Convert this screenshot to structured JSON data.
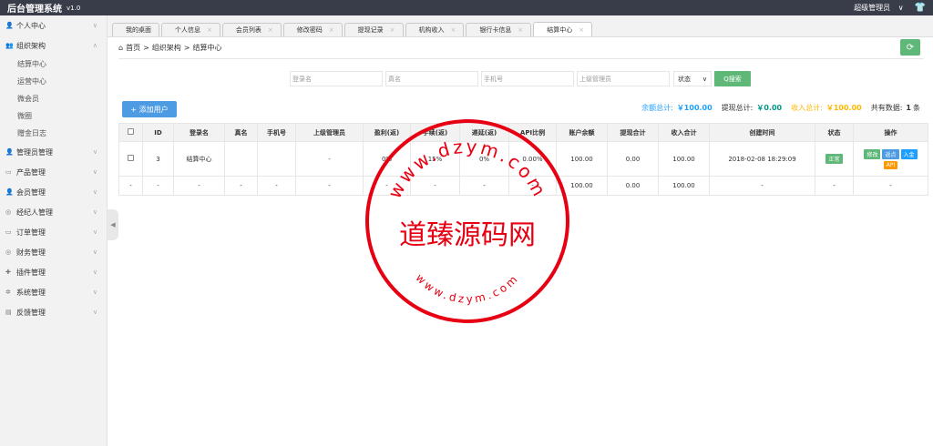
{
  "topbar": {
    "title": "后台管理系统",
    "version": "v1.0",
    "user": "超级管理员",
    "user_chevron": "∨",
    "shirt_icon": "👕"
  },
  "sidebar": {
    "items": [
      {
        "icon": "user-icon",
        "glyph": "👤",
        "label": "个人中心",
        "arrow": "∨"
      },
      {
        "icon": "org-icon",
        "glyph": "👥",
        "label": "组织架构",
        "arrow": "∧"
      },
      {
        "icon": "admin-icon",
        "glyph": "👤",
        "label": "管理员管理",
        "arrow": "∨"
      },
      {
        "icon": "product-icon",
        "glyph": "▭",
        "label": "产品管理",
        "arrow": "∨"
      },
      {
        "icon": "member-icon",
        "glyph": "👤",
        "label": "会员管理",
        "arrow": "∨"
      },
      {
        "icon": "broker-icon",
        "glyph": "◎",
        "label": "经纪人管理",
        "arrow": "∨"
      },
      {
        "icon": "order-icon",
        "glyph": "▭",
        "label": "订单管理",
        "arrow": "∨"
      },
      {
        "icon": "finance-icon",
        "glyph": "◎",
        "label": "财务管理",
        "arrow": "∨"
      },
      {
        "icon": "plugin-icon",
        "glyph": "✚",
        "label": "插件管理",
        "arrow": "∨"
      },
      {
        "icon": "system-icon",
        "glyph": "✲",
        "label": "系统管理",
        "arrow": "∨"
      },
      {
        "icon": "feedback-icon",
        "glyph": "▤",
        "label": "反馈管理",
        "arrow": "∨"
      }
    ],
    "subitems": [
      "结算中心",
      "运营中心",
      "微会员",
      "微圈",
      "赠金日志"
    ],
    "collapse_glyph": "◀"
  },
  "tabs": [
    {
      "label": "我的桌面",
      "close": ""
    },
    {
      "label": "个人信息",
      "close": "×"
    },
    {
      "label": "会员列表",
      "close": "×"
    },
    {
      "label": "修改密码",
      "close": "×"
    },
    {
      "label": "提现记录",
      "close": "×"
    },
    {
      "label": "机构收入",
      "close": "×"
    },
    {
      "label": "银行卡信息",
      "close": "×"
    },
    {
      "label": "结算中心",
      "close": "×"
    }
  ],
  "breadcrumb": {
    "home_icon": "⌂",
    "home": "首页",
    "sep": ">",
    "level1": "组织架构",
    "level2": "结算中心"
  },
  "refresh_icon": "⟳",
  "search": {
    "username_placeholder": "登录名",
    "realname_placeholder": "真名",
    "phone_placeholder": "手机号",
    "parent_placeholder": "上级管理员",
    "status_label": "状态",
    "status_chevron": "∨",
    "search_label": "Q搜索"
  },
  "add_user_label": "+ 添加用户",
  "totals": {
    "balance_label": "余额总计:",
    "balance_value": "￥100.00",
    "withdraw_label": "提现总计:",
    "withdraw_value": "￥0.00",
    "income_label": "收入总计:",
    "income_value": "￥100.00",
    "count_label": "共有数据:",
    "count_value": "1",
    "count_unit": "条"
  },
  "table": {
    "headers": [
      "",
      "ID",
      "登录名",
      "真名",
      "手机号",
      "上级管理员",
      "盈利(返)",
      "手续(返)",
      "递延(返)",
      "API比例",
      "账户余额",
      "提现合计",
      "收入合计",
      "创建时间",
      "状态",
      "操作"
    ],
    "row": {
      "id": "3",
      "username": "结算中心",
      "realname": "",
      "phone": "",
      "parent": "-",
      "profit": "0%",
      "fee": "15%",
      "deferred": "0%",
      "api": "0.00%",
      "balance": "100.00",
      "withdraw": "0.00",
      "income": "100.00",
      "created": "2018-02-08 18:29:09",
      "status": "正常",
      "ops": {
        "edit": "修改",
        "rebate": "返点",
        "deposit": "入金",
        "api": "API"
      }
    },
    "summary": {
      "c0": "-",
      "c1": "-",
      "c2": "-",
      "c3": "-",
      "c4": "-",
      "c5": "-",
      "c6": "-",
      "c7": "-",
      "c8": "-",
      "c9": "-",
      "balance": "100.00",
      "withdraw": "0.00",
      "income": "100.00",
      "created": "-",
      "status": "-",
      "ops": "-"
    }
  },
  "watermark": {
    "center": "道臻源码网",
    "ring_top": "www.dzym.com",
    "ring_bottom": "www.dzym.com"
  },
  "colors": {
    "topbar": "#393d49",
    "green": "#5fb878",
    "blue": "#1e9fff",
    "orange": "#ffb800",
    "stamp_red": "#e60012"
  }
}
